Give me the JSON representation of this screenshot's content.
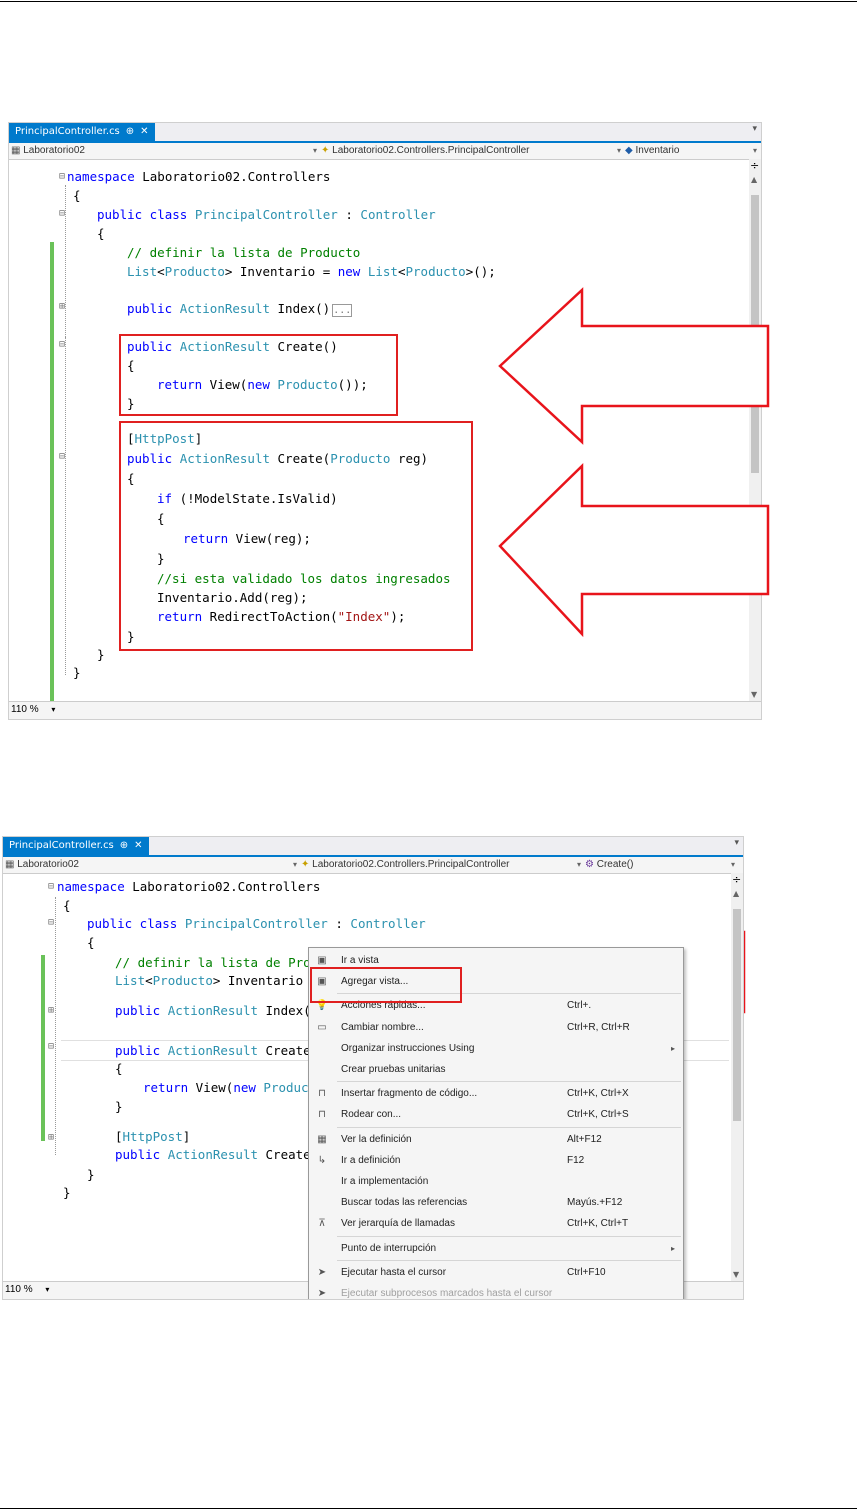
{
  "screenshot1": {
    "tab_label": "PrincipalController.cs",
    "tab_pin": "⊕",
    "tab_close": "✕",
    "nav_project": "Laboratorio02",
    "nav_class": "Laboratorio02.Controllers.PrincipalController",
    "nav_member": "Inventario",
    "zoom": "110 %",
    "code": {
      "l1_kw": "namespace",
      "l1_rest": " Laboratorio02.Controllers",
      "l2": "{",
      "l3_kw": "public class",
      "l3_ty": "PrincipalController",
      "l3_mid": " : ",
      "l3_ty2": "Controller",
      "l4": "{",
      "l5_cm": "// definir la lista de Producto",
      "l6_ty": "List",
      "l6_a": "<",
      "l6_ty2": "Producto",
      "l6_b": "> Inventario = ",
      "l6_kw": "new",
      "l6_ty3": "List",
      "l6_c": "<",
      "l6_ty4": "Producto",
      "l6_d": ">();",
      "l7_kw": "public",
      "l7_ty": "ActionResult",
      "l7_rest": " Index()",
      "l7_fold": "...",
      "l8_kw": "public",
      "l8_ty": "ActionResult",
      "l8_rest": " Create()",
      "l9": "{",
      "l10_kw": "return",
      "l10_a": " View(",
      "l10_kw2": "new",
      "l10_ty": "Producto",
      "l10_b": "());",
      "l11": "}",
      "l12_a": "[",
      "l12_ty": "HttpPost",
      "l12_b": "]",
      "l13_kw": "public",
      "l13_ty": "ActionResult",
      "l13_a": " Create(",
      "l13_ty2": "Producto",
      "l13_b": " reg)",
      "l14": "{",
      "l15_kw": "if",
      "l15_rest": " (!ModelState.IsValid)",
      "l16": "{",
      "l17_kw": "return",
      "l17_rest": " View(reg);",
      "l18": "}",
      "l19_cm": "//si esta validado los datos ingresados",
      "l20": "Inventario.Add(reg);",
      "l21_kw": "return",
      "l21_a": " RedirectToAction(",
      "l21_st": "\"Index\"",
      "l21_b": ");",
      "l22": "}",
      "l23": "}",
      "l24": "}"
    }
  },
  "screenshot2": {
    "tab_label": "PrincipalController.cs",
    "tab_pin": "⊕",
    "tab_close": "✕",
    "nav_project": "Laboratorio02",
    "nav_class": "Laboratorio02.Controllers.PrincipalController",
    "nav_member": "Create()",
    "zoom": "110 %",
    "code": {
      "l1_kw": "namespace",
      "l1_rest": " Laboratorio02.Controllers",
      "l2": "{",
      "l3_kw": "public class",
      "l3_ty": "PrincipalController",
      "l3_mid": " : ",
      "l3_ty2": "Controller",
      "l4": "{",
      "l5_cm": "// definir la lista de Produ",
      "l6_ty": "List",
      "l6_a": "<",
      "l6_ty2": "Producto",
      "l6_b": "> Inventario =",
      "l7_kw": "public",
      "l7_ty": "ActionResult",
      "l7_rest": " Index()",
      "l8_kw": "public",
      "l8_ty": "ActionResult",
      "l8_rest": " Create()",
      "l9": "{",
      "l10_kw": "return",
      "l10_a": " View(",
      "l10_kw2": "new",
      "l10_ty": "Producto",
      "l11": "}",
      "l12_a": "[",
      "l12_ty": "HttpPost",
      "l12_b": "]",
      "l13_kw": "public",
      "l13_ty": "ActionResult",
      "l13_a": " Create(",
      "l14": "}",
      "l15": "}"
    },
    "context_menu": [
      {
        "icon": "view-icon",
        "glyph": "▣",
        "label": "Ir a vista",
        "shortcut": "",
        "submenu": false
      },
      {
        "icon": "add-view-icon",
        "glyph": "▣",
        "label": "Agregar vista...",
        "shortcut": "",
        "submenu": false
      },
      {
        "icon": "lightbulb-icon",
        "glyph": "💡",
        "label": "Acciones rápidas...",
        "shortcut": "Ctrl+.",
        "submenu": false
      },
      {
        "icon": "rename-icon",
        "glyph": "▭",
        "label": "Cambiar nombre...",
        "shortcut": "Ctrl+R, Ctrl+R",
        "submenu": false
      },
      {
        "icon": "",
        "glyph": "",
        "label": "Organizar instrucciones Using",
        "shortcut": "",
        "submenu": true
      },
      {
        "icon": "",
        "glyph": "",
        "label": "Crear pruebas unitarias",
        "shortcut": "",
        "submenu": false
      },
      {
        "icon": "snippet-icon",
        "glyph": "⊓",
        "label": "Insertar fragmento de código...",
        "shortcut": "Ctrl+K, Ctrl+X",
        "submenu": false
      },
      {
        "icon": "surround-icon",
        "glyph": "⊓",
        "label": "Rodear con...",
        "shortcut": "Ctrl+K, Ctrl+S",
        "submenu": false
      },
      {
        "icon": "peek-icon",
        "glyph": "▦",
        "label": "Ver la definición",
        "shortcut": "Alt+F12",
        "submenu": false
      },
      {
        "icon": "goto-def-icon",
        "glyph": "↳",
        "label": "Ir a definición",
        "shortcut": "F12",
        "submenu": false
      },
      {
        "icon": "",
        "glyph": "",
        "label": "Ir a implementación",
        "shortcut": "",
        "submenu": false
      },
      {
        "icon": "",
        "glyph": "",
        "label": "Buscar todas las referencias",
        "shortcut": "Mayús.+F12",
        "submenu": false
      },
      {
        "icon": "call-hierarchy-icon",
        "glyph": "⊼",
        "label": "Ver jerarquía de llamadas",
        "shortcut": "Ctrl+K, Ctrl+T",
        "submenu": false
      },
      {
        "icon": "",
        "glyph": "",
        "label": "Punto de interrupción",
        "shortcut": "",
        "submenu": true
      },
      {
        "icon": "run-cursor-icon",
        "glyph": "➤",
        "label": "Ejecutar hasta el cursor",
        "shortcut": "Ctrl+F10",
        "submenu": false
      },
      {
        "icon": "run-marked-icon",
        "glyph": "➤",
        "label": "Ejecutar subprocesos marcados hasta el cursor",
        "shortcut": "",
        "submenu": false,
        "disabled": true
      }
    ]
  },
  "colors": {
    "accent": "#007acc",
    "highlight_box": "#e02020",
    "keyword": "#0000ff",
    "type": "#2b91af",
    "comment": "#008000",
    "string": "#a31515",
    "change_bar": "#6ac259"
  }
}
